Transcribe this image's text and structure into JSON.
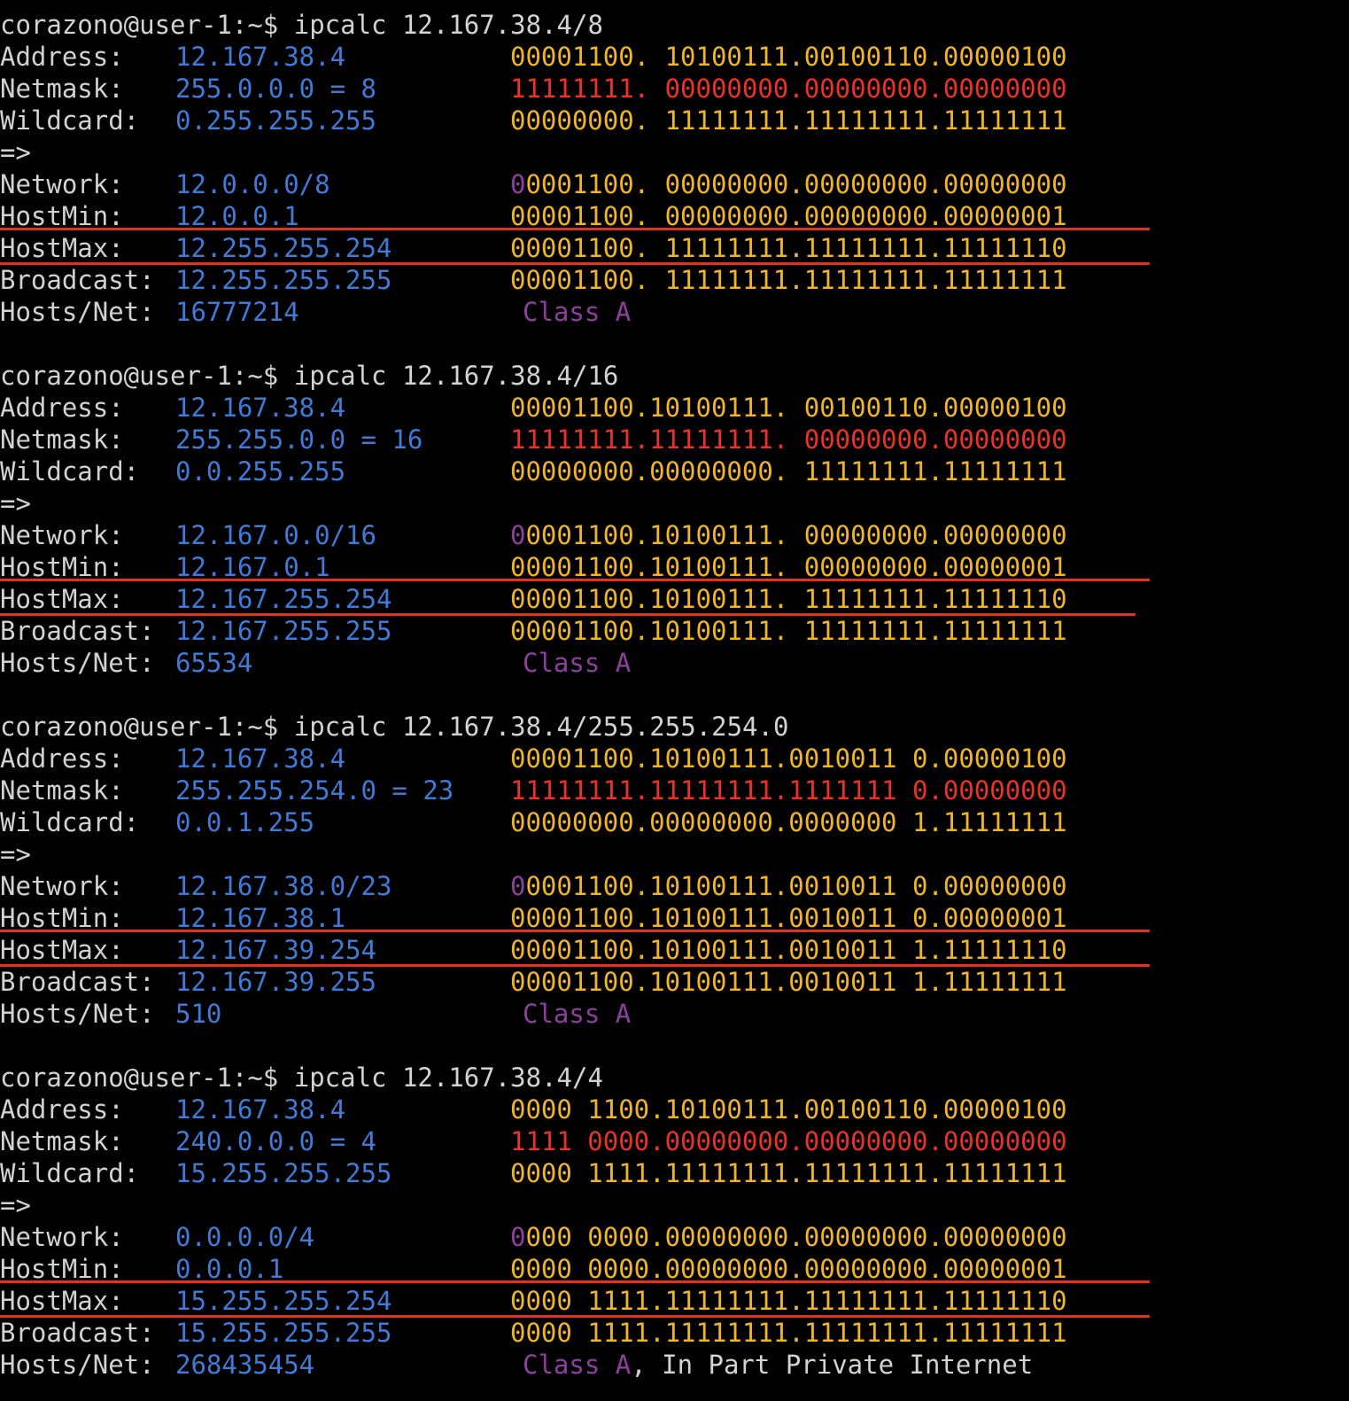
{
  "colors": {
    "background": "#000000",
    "text": "#d2d2d2",
    "value": "#3e7ad6",
    "binary": "#f0b429",
    "netmask_bits": "#e8322a",
    "class": "#8e3f9e",
    "highlight": "#e0331f"
  },
  "labels": {
    "address": "Address:",
    "netmask": "Netmask:",
    "wildcard": "Wildcard:",
    "arrow": "=>",
    "network": "Network:",
    "hostmin": "HostMin:",
    "hostmax": "HostMax:",
    "broadcast": "Broadcast:",
    "hosts": "Hosts/Net:"
  },
  "blocks": [
    {
      "prompt": "corazono@user-1:~$ ipcalc 12.167.38.4/8",
      "address": "12.167.38.4",
      "netmask": "255.0.0.0 = 8",
      "wildcard": "0.255.255.255",
      "network": "12.0.0.0/8",
      "hostmin": "12.0.0.1",
      "hostmax": "12.255.255.254",
      "broadcast": "12.255.255.255",
      "hosts": "16777214",
      "class": "Class A",
      "class_extra": "",
      "bin": {
        "address": [
          {
            "t": "00001100. 10100111.00100110.00000100",
            "c": "y"
          }
        ],
        "netmask": [
          {
            "t": "11111111. 00000000.00000000.00000000",
            "c": "r"
          }
        ],
        "wildcard": [
          {
            "t": "00000000. 11111111.11111111.11111111",
            "c": "y"
          }
        ],
        "network": [
          {
            "t": "0",
            "c": "p"
          },
          {
            "t": "0001100. 00000000.00000000.00000000",
            "c": "y"
          }
        ],
        "hostmin": [
          {
            "t": "00001100. 00000000.00000000.00000001",
            "c": "y"
          }
        ],
        "hostmax": [
          {
            "t": "00001100. 11111111.11111111.11111110",
            "c": "y"
          }
        ],
        "broadcast": [
          {
            "t": "00001100. 11111111.11111111.11111111",
            "c": "y"
          }
        ]
      }
    },
    {
      "prompt": "corazono@user-1:~$ ipcalc 12.167.38.4/16",
      "address": "12.167.38.4",
      "netmask": "255.255.0.0 = 16",
      "wildcard": "0.0.255.255",
      "network": "12.167.0.0/16",
      "hostmin": "12.167.0.1",
      "hostmax": "12.167.255.254",
      "broadcast": "12.167.255.255",
      "hosts": "65534",
      "class": "Class A",
      "class_extra": "",
      "bin": {
        "address": [
          {
            "t": "00001100.10100111. 00100110.00000100",
            "c": "y"
          }
        ],
        "netmask": [
          {
            "t": "11111111.11111111. 00000000.00000000",
            "c": "r"
          }
        ],
        "wildcard": [
          {
            "t": "00000000.00000000. 11111111.11111111",
            "c": "y"
          }
        ],
        "network": [
          {
            "t": "0",
            "c": "p"
          },
          {
            "t": "0001100.10100111. 00000000.00000000",
            "c": "y"
          }
        ],
        "hostmin": [
          {
            "t": "00001100.10100111. 00000000.00000001",
            "c": "y"
          }
        ],
        "hostmax": [
          {
            "t": "00001100.10100111. 11111111.11111110",
            "c": "y"
          }
        ],
        "broadcast": [
          {
            "t": "00001100.10100111. 11111111.11111111",
            "c": "y"
          }
        ]
      }
    },
    {
      "prompt": "corazono@user-1:~$ ipcalc 12.167.38.4/255.255.254.0",
      "address": "12.167.38.4",
      "netmask": "255.255.254.0 = 23",
      "wildcard": "0.0.1.255",
      "network": "12.167.38.0/23",
      "hostmin": "12.167.38.1",
      "hostmax": "12.167.39.254",
      "broadcast": "12.167.39.255",
      "hosts": "510",
      "class": "Class A",
      "class_extra": "",
      "bin": {
        "address": [
          {
            "t": "00001100.10100111.0010011 0.00000100",
            "c": "y"
          }
        ],
        "netmask": [
          {
            "t": "11111111.11111111.1111111 0.00000000",
            "c": "r"
          }
        ],
        "wildcard": [
          {
            "t": "00000000.00000000.0000000 1.11111111",
            "c": "y"
          }
        ],
        "network": [
          {
            "t": "0",
            "c": "p"
          },
          {
            "t": "0001100.10100111.0010011 0.00000000",
            "c": "y"
          }
        ],
        "hostmin": [
          {
            "t": "00001100.10100111.0010011 0.00000001",
            "c": "y"
          }
        ],
        "hostmax": [
          {
            "t": "00001100.10100111.0010011 1.11111110",
            "c": "y"
          }
        ],
        "broadcast": [
          {
            "t": "00001100.10100111.0010011 1.11111111",
            "c": "y"
          }
        ]
      }
    },
    {
      "prompt": "corazono@user-1:~$ ipcalc 12.167.38.4/4",
      "address": "12.167.38.4",
      "netmask": "240.0.0.0 = 4",
      "wildcard": "15.255.255.255",
      "network": "0.0.0.0/4",
      "hostmin": "0.0.0.1",
      "hostmax": "15.255.255.254",
      "broadcast": "15.255.255.255",
      "hosts": "268435454",
      "class": "Class A",
      "class_extra": ", In Part Private Internet",
      "bin": {
        "address": [
          {
            "t": "0000 1100.10100111.00100110.00000100",
            "c": "y"
          }
        ],
        "netmask": [
          {
            "t": "1111 0000.00000000.00000000.00000000",
            "c": "r"
          }
        ],
        "wildcard": [
          {
            "t": "0000 1111.11111111.11111111.11111111",
            "c": "y"
          }
        ],
        "network": [
          {
            "t": "0",
            "c": "p"
          },
          {
            "t": "000 0000.00000000.00000000.00000000",
            "c": "y"
          }
        ],
        "hostmin": [
          {
            "t": "0000 0000.00000000.00000000.00000001",
            "c": "y"
          }
        ],
        "hostmax": [
          {
            "t": "0000 1111.11111111.11111111.11111110",
            "c": "y"
          }
        ],
        "broadcast": [
          {
            "t": "0000 1111.11111111.11111111.11111111",
            "c": "y"
          }
        ]
      }
    }
  ]
}
